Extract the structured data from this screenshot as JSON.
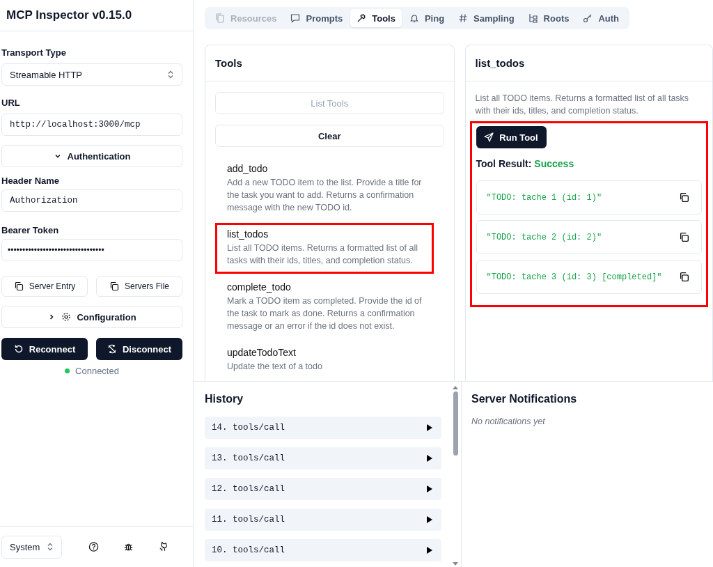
{
  "app": {
    "title": "MCP Inspector v0.15.0"
  },
  "sidebar": {
    "transport": {
      "label": "Transport Type",
      "value": "Streamable HTTP"
    },
    "url": {
      "label": "URL",
      "value": "http://localhost:3000/mcp"
    },
    "authentication": {
      "label": "Authentication",
      "expanded": true
    },
    "header_name": {
      "label": "Header Name",
      "value": "Authorization"
    },
    "bearer_token": {
      "label": "Bearer Token",
      "value": "•••••••••••••••••••••••••••••••••"
    },
    "copy_buttons": [
      "Server Entry",
      "Servers File"
    ],
    "configuration": {
      "label": "Configuration",
      "expanded": false
    },
    "actions": [
      "Reconnect",
      "Disconnect"
    ],
    "status": {
      "label": "Connected",
      "color": "#22c55e"
    },
    "theme": {
      "value": "System"
    }
  },
  "tabs": [
    {
      "label": "Resources",
      "kind": "resources",
      "selected": false,
      "disabled": true
    },
    {
      "label": "Prompts",
      "kind": "prompts",
      "selected": false,
      "disabled": false
    },
    {
      "label": "Tools",
      "kind": "tools",
      "selected": true,
      "disabled": false
    },
    {
      "label": "Ping",
      "kind": "ping",
      "selected": false,
      "disabled": false
    },
    {
      "label": "Sampling",
      "kind": "sampling",
      "selected": false,
      "disabled": false
    },
    {
      "label": "Roots",
      "kind": "roots",
      "selected": false,
      "disabled": false
    },
    {
      "label": "Auth",
      "kind": "auth",
      "selected": false,
      "disabled": false
    }
  ],
  "tools_panel": {
    "title": "Tools",
    "list_button": {
      "label": "List Tools",
      "disabled": true
    },
    "clear_button": "Clear",
    "tools": [
      {
        "name": "add_todo",
        "description": "Add a new TODO item to the list. Provide a title for the task you want to add. Returns a confirmation message with the new TODO id.",
        "highlighted": false
      },
      {
        "name": "list_todos",
        "description": "List all TODO items. Returns a formatted list of all tasks with their ids, titles, and completion status.",
        "highlighted": true
      },
      {
        "name": "complete_todo",
        "description": "Mark a TODO item as completed. Provide the id of the task to mark as done. Returns a confirmation message or an error if the id does not exist.",
        "highlighted": false
      },
      {
        "name": "updateTodoText",
        "description": "Update the text of a todo",
        "highlighted": false
      }
    ]
  },
  "tool_panel": {
    "title": "list_todos",
    "description": "List all TODO items. Returns a formatted list of all tasks with their ids, titles, and completion status.",
    "run_button": "Run Tool",
    "result_label": "Tool Result:",
    "result_status": "Success",
    "highlighted": true,
    "results": [
      "\"TODO: tache 1 (id: 1)\"",
      "\"TODO: tache 2 (id: 2)\"",
      "\"TODO: tache 3 (id: 3) [completed]\""
    ]
  },
  "history": {
    "title": "History",
    "entries": [
      "14. tools/call",
      "13. tools/call",
      "12. tools/call",
      "11. tools/call",
      "10. tools/call"
    ]
  },
  "notifications": {
    "title": "Server Notifications",
    "empty_text": "No notifications yet"
  }
}
